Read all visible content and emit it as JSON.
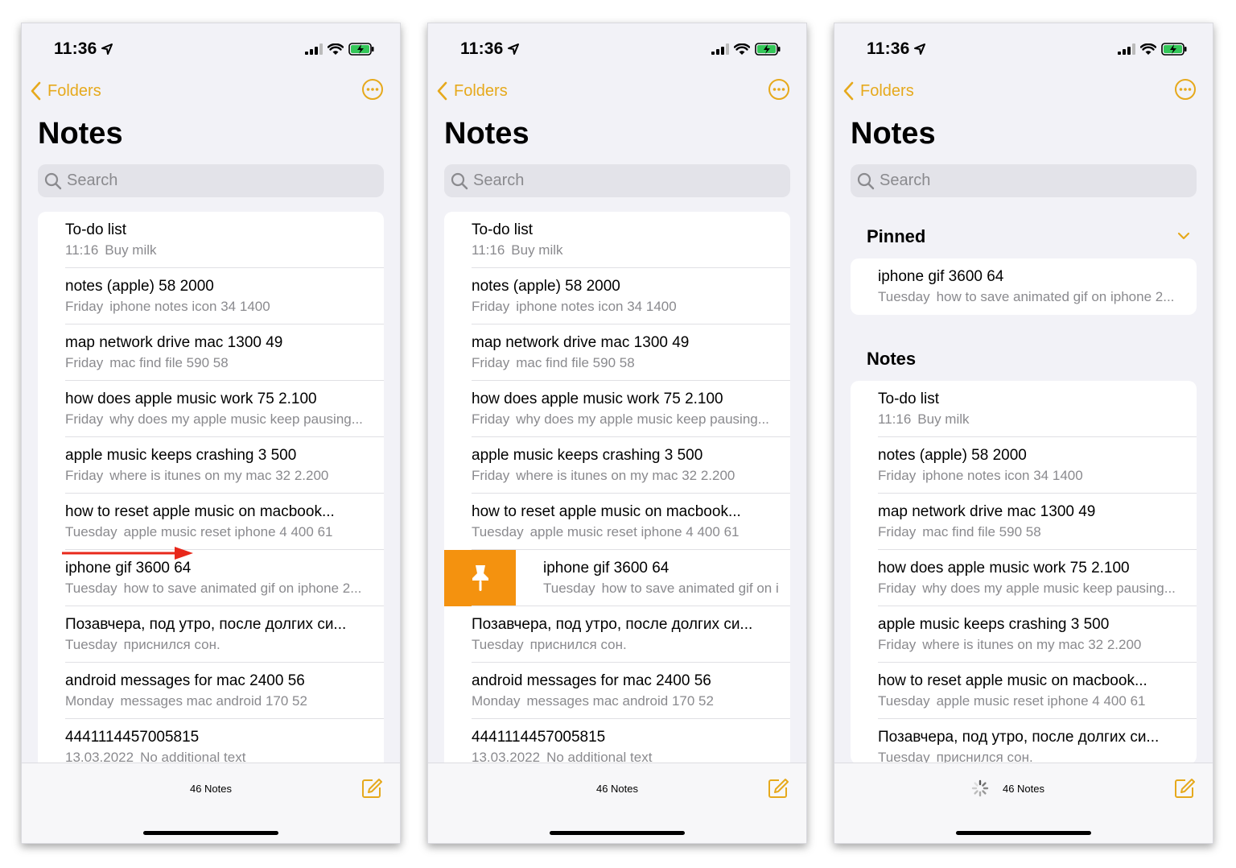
{
  "status": {
    "time": "11:36"
  },
  "nav": {
    "back_label": "Folders"
  },
  "header": {
    "title": "Notes"
  },
  "search": {
    "placeholder": "Search"
  },
  "notes": [
    {
      "title": "To-do list",
      "date": "11:16",
      "snippet": "Buy milk"
    },
    {
      "title": "notes (apple)   58  2000",
      "date": "Friday",
      "snippet": "iphone notes icon 34 1400"
    },
    {
      "title": "map network drive mac  1300  49",
      "date": "Friday",
      "snippet": "mac find file 590 58"
    },
    {
      "title": "how does apple music work    75  2.100",
      "date": "Friday",
      "snippet": "why does my apple music keep pausing..."
    },
    {
      "title": "apple music keeps crashing   3    500",
      "date": "Friday",
      "snippet": "where is itunes on my mac 32 2.200"
    },
    {
      "title": "how to reset apple music on macbook...",
      "date": "Tuesday",
      "snippet": "apple music reset iphone 4 400 61"
    },
    {
      "title": "iphone gif  3600  64",
      "date": "Tuesday",
      "snippet": "how to save animated gif on iphone 2..."
    },
    {
      "title": "Позавчера, под утро, после долгих си...",
      "date": "Tuesday",
      "snippet": "приснился сон."
    },
    {
      "title": "android messages for mac  2400   56",
      "date": "Monday",
      "snippet": "messages mac android 170 52"
    },
    {
      "title": "4441114457005815",
      "date": "13.03.2022",
      "snippet": "No additional text"
    }
  ],
  "swiped_snippet": "how to save animated gif on i",
  "sections": {
    "pinned": "Pinned",
    "notes": "Notes"
  },
  "toolbar": {
    "count": "46 Notes"
  },
  "icons": {
    "pin": "pin-icon",
    "compose": "compose-icon",
    "more": "more-icon",
    "search": "search-icon",
    "back": "chevron-left-icon"
  },
  "colors": {
    "accent": "#e6a91c",
    "pin": "#f4920f",
    "arrow": "#e8281b"
  }
}
